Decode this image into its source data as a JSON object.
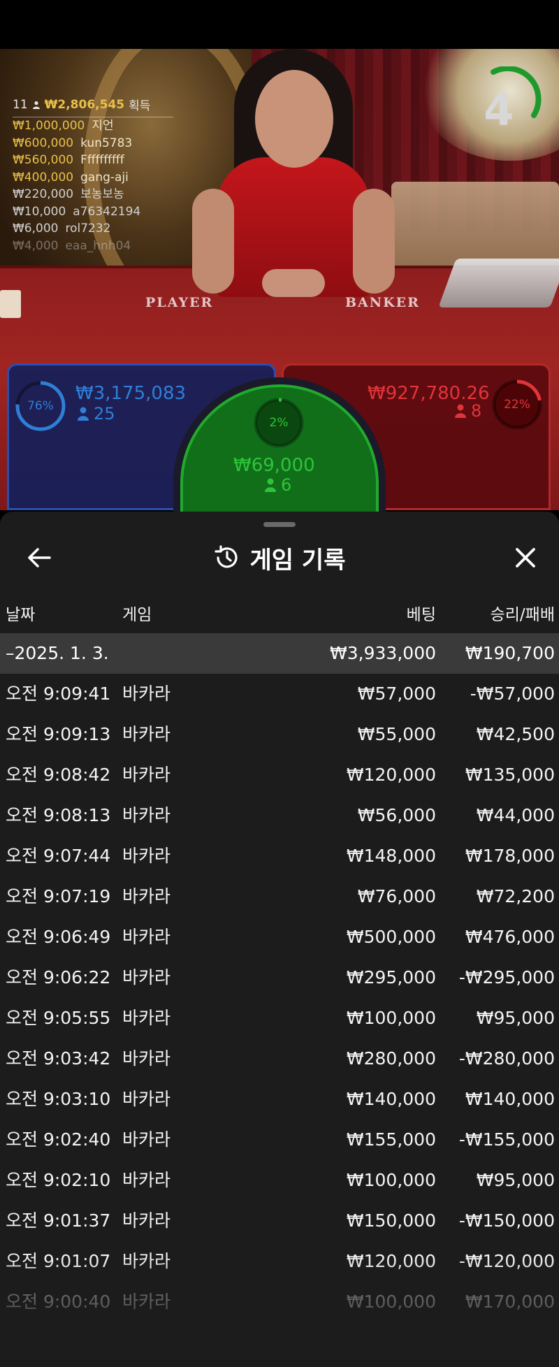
{
  "stream": {
    "table_labels": {
      "player": "PLAYER",
      "banker": "BANKER"
    },
    "countdown": "4",
    "winners": {
      "count": "11",
      "total": "₩2,806,545",
      "total_suffix": "획득",
      "entries": [
        {
          "amount": "₩1,000,000",
          "name": "지언"
        },
        {
          "amount": "₩600,000",
          "name": "kun5783"
        },
        {
          "amount": "₩560,000",
          "name": "Ffffffffff"
        },
        {
          "amount": "₩400,000",
          "name": "gang-aji"
        },
        {
          "amount": "₩220,000",
          "name": "보농보농"
        },
        {
          "amount": "₩10,000",
          "name": "a76342194"
        },
        {
          "amount": "₩6,000",
          "name": "rol7232"
        },
        {
          "amount": "₩4,000",
          "name": "eaa_hnh04"
        }
      ]
    },
    "bets": {
      "player": {
        "percent_label": "76%",
        "percent": 76,
        "amount": "₩3,175,083",
        "players": "25",
        "color": "#2f7fd6"
      },
      "tie": {
        "percent_label": "2%",
        "percent": 2,
        "amount": "₩69,000",
        "players": "6",
        "color": "#2ec43a"
      },
      "banker": {
        "percent_label": "22%",
        "percent": 22,
        "amount": "₩927,780.26",
        "players": "8",
        "color": "#e0353a"
      }
    }
  },
  "history": {
    "title": "게임 기록",
    "icons": {
      "back": "arrow-left-icon",
      "title": "history-clock-icon",
      "close": "close-x-icon"
    },
    "columns": {
      "date": "날짜",
      "game": "게임",
      "bet": "베팅",
      "result": "승리/패배"
    },
    "day": {
      "label": "–2025. 1. 3.",
      "bet_total": "₩3,933,000",
      "result_total": "₩190,700"
    },
    "rows": [
      {
        "time": "오전 9:09:41",
        "game": "바카라",
        "bet": "₩57,000",
        "result": "-₩57,000"
      },
      {
        "time": "오전 9:09:13",
        "game": "바카라",
        "bet": "₩55,000",
        "result": "₩42,500"
      },
      {
        "time": "오전 9:08:42",
        "game": "바카라",
        "bet": "₩120,000",
        "result": "₩135,000"
      },
      {
        "time": "오전 9:08:13",
        "game": "바카라",
        "bet": "₩56,000",
        "result": "₩44,000"
      },
      {
        "time": "오전 9:07:44",
        "game": "바카라",
        "bet": "₩148,000",
        "result": "₩178,000"
      },
      {
        "time": "오전 9:07:19",
        "game": "바카라",
        "bet": "₩76,000",
        "result": "₩72,200"
      },
      {
        "time": "오전 9:06:49",
        "game": "바카라",
        "bet": "₩500,000",
        "result": "₩476,000"
      },
      {
        "time": "오전 9:06:22",
        "game": "바카라",
        "bet": "₩295,000",
        "result": "-₩295,000"
      },
      {
        "time": "오전 9:05:55",
        "game": "바카라",
        "bet": "₩100,000",
        "result": "₩95,000"
      },
      {
        "time": "오전 9:03:42",
        "game": "바카라",
        "bet": "₩280,000",
        "result": "-₩280,000"
      },
      {
        "time": "오전 9:03:10",
        "game": "바카라",
        "bet": "₩140,000",
        "result": "₩140,000"
      },
      {
        "time": "오전 9:02:40",
        "game": "바카라",
        "bet": "₩155,000",
        "result": "-₩155,000"
      },
      {
        "time": "오전 9:02:10",
        "game": "바카라",
        "bet": "₩100,000",
        "result": "₩95,000"
      },
      {
        "time": "오전 9:01:37",
        "game": "바카라",
        "bet": "₩150,000",
        "result": "-₩150,000"
      },
      {
        "time": "오전 9:01:07",
        "game": "바카라",
        "bet": "₩120,000",
        "result": "-₩120,000"
      },
      {
        "time": "오전 9:00:40",
        "game": "바카라",
        "bet": "₩100,000",
        "result": "₩170,000"
      }
    ]
  }
}
